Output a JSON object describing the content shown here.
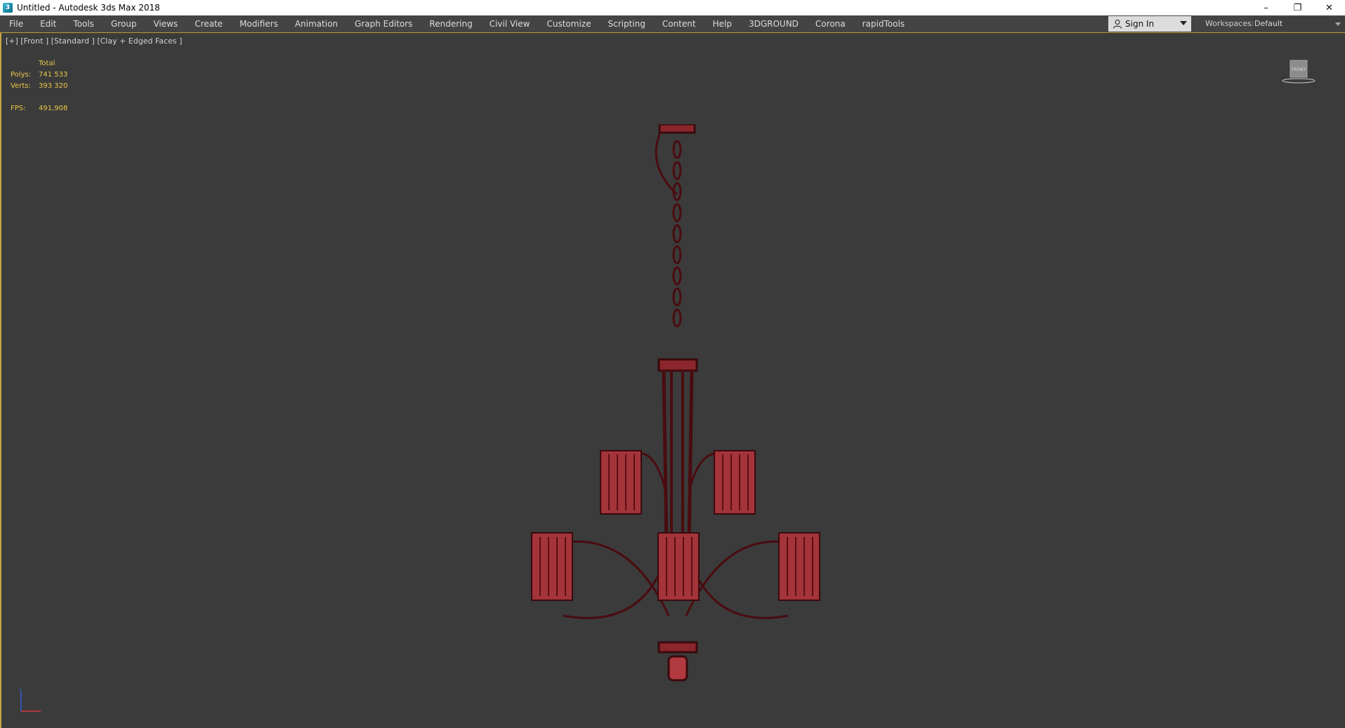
{
  "window": {
    "title": "Untitled - Autodesk 3ds Max 2018",
    "app_icon_glyph": "3",
    "controls": {
      "minimize": "–",
      "restore": "❐",
      "close": "✕"
    }
  },
  "menu": {
    "items": [
      "File",
      "Edit",
      "Tools",
      "Group",
      "Views",
      "Create",
      "Modifiers",
      "Animation",
      "Graph Editors",
      "Rendering",
      "Civil View",
      "Customize",
      "Scripting",
      "Content",
      "Help",
      "3DGROUND",
      "Corona",
      "rapidTools"
    ]
  },
  "account": {
    "sign_in_label": "Sign In"
  },
  "workspaces": {
    "label": "Workspaces:",
    "value": "Default"
  },
  "viewport": {
    "label": "[+] [Front ] [Standard ] [Clay + Edged Faces ]",
    "stats": {
      "total_label": "Total",
      "polys_label": "Polys:",
      "polys_value": "741 533",
      "verts_label": "Verts:",
      "verts_value": "393 320",
      "fps_label": "FPS:",
      "fps_value": "491,908"
    },
    "viewcube_label": "FRONT",
    "colors": {
      "wire": "#5a0f12",
      "fill": "#b13a40",
      "stats": "#e8c84a"
    }
  }
}
